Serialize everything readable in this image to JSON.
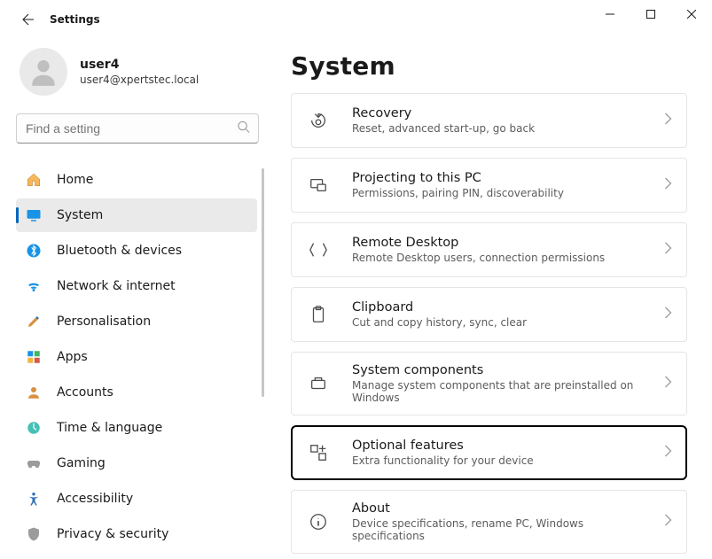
{
  "window": {
    "title": "Settings"
  },
  "user": {
    "name": "user4",
    "email": "user4@xpertstec.local"
  },
  "search": {
    "placeholder": "Find a setting"
  },
  "nav": {
    "items": [
      {
        "label": "Home"
      },
      {
        "label": "System"
      },
      {
        "label": "Bluetooth & devices"
      },
      {
        "label": "Network & internet"
      },
      {
        "label": "Personalisation"
      },
      {
        "label": "Apps"
      },
      {
        "label": "Accounts"
      },
      {
        "label": "Time & language"
      },
      {
        "label": "Gaming"
      },
      {
        "label": "Accessibility"
      },
      {
        "label": "Privacy & security"
      }
    ],
    "active_index": 1
  },
  "page": {
    "title": "System",
    "cards": [
      {
        "title": "Recovery",
        "sub": "Reset, advanced start-up, go back"
      },
      {
        "title": "Projecting to this PC",
        "sub": "Permissions, pairing PIN, discoverability"
      },
      {
        "title": "Remote Desktop",
        "sub": "Remote Desktop users, connection permissions"
      },
      {
        "title": "Clipboard",
        "sub": "Cut and copy history, sync, clear"
      },
      {
        "title": "System components",
        "sub": "Manage system components that are preinstalled on Windows"
      },
      {
        "title": "Optional features",
        "sub": "Extra functionality for your device"
      },
      {
        "title": "About",
        "sub": "Device specifications, rename PC, Windows specifications"
      }
    ],
    "focused_index": 5
  }
}
